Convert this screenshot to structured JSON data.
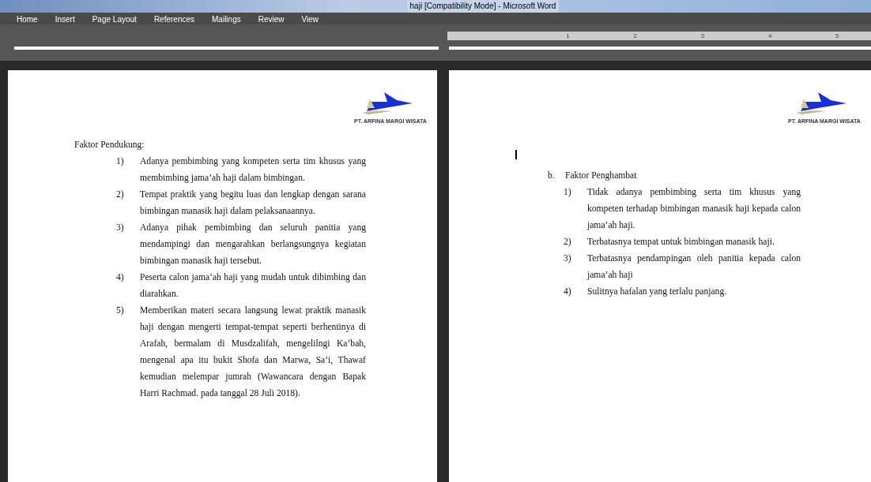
{
  "window": {
    "title": "haji [Compatibility Mode] - Microsoft Word"
  },
  "ribbon_tabs": [
    {
      "label": "Home"
    },
    {
      "label": "Insert"
    },
    {
      "label": "Page Layout"
    },
    {
      "label": "References"
    },
    {
      "label": "Mailings"
    },
    {
      "label": "Review"
    },
    {
      "label": "View"
    }
  ],
  "ruler": {
    "numbers": [
      "1",
      "2",
      "3",
      "4",
      "5"
    ]
  },
  "pages": [
    {
      "logo_caption": "PT. ARFINA MARGI WISATA",
      "heading": "Faktor Pendukung:",
      "items": [
        {
          "number": "1)",
          "text": "Adanya pembimbing yang kompeten serta tim khusus yang membimbing jama’ah haji dalam bimbingan."
        },
        {
          "number": "2)",
          "text": "Tempat praktik yang begitu luas dan lengkap dengan sarana bimbingan manasik haji dalam pelaksanaannya."
        },
        {
          "number": "3)",
          "text": "Adanya pihak pembimbing dan seluruh panitia yang mendampingi dan mengarahkan berlangsungnya kegiatan bimbingan manasik haji tersebut."
        },
        {
          "number": "4)",
          "text": "Peserta calon jama’ah haji yang mudah untuk dibimbing dan diarahkan."
        },
        {
          "number": "5)",
          "text": "Memberikan materi secara langsung lewat praktik manasik haji dengan mengerti tempat-tempat seperti berhentinya di Arafah, bermalam di Musdzalifah, mengelilngi Ka’bah, mengenal apa itu bukit Shofa dan Marwa, Sa’i, Thawaf kemudian melempar jumrah (Wawancara dengan Bapak Harri Rachmad. pada tanggal 28 Juli 2018)."
        }
      ]
    },
    {
      "logo_caption": "PT. ARFINA MARGI WISATA",
      "marker": "b.",
      "heading": "Faktor Penghambat",
      "items": [
        {
          "number": "1)",
          "text": "Tidak adanya pembimbing serta tim khusus yang kompeten terhadap bimbingan manasik haji kepada calon jama’ah haji."
        },
        {
          "number": "2)",
          "text": "Terbatasnya tempat untuk bimbingan manasik haji."
        },
        {
          "number": "3)",
          "text": "Terbatasnya pendampingan oleh panitia kepada calon jama’ah haji"
        },
        {
          "number": "4)",
          "text": "Sulitnya hafalan yang terlalu panjang."
        }
      ]
    }
  ]
}
